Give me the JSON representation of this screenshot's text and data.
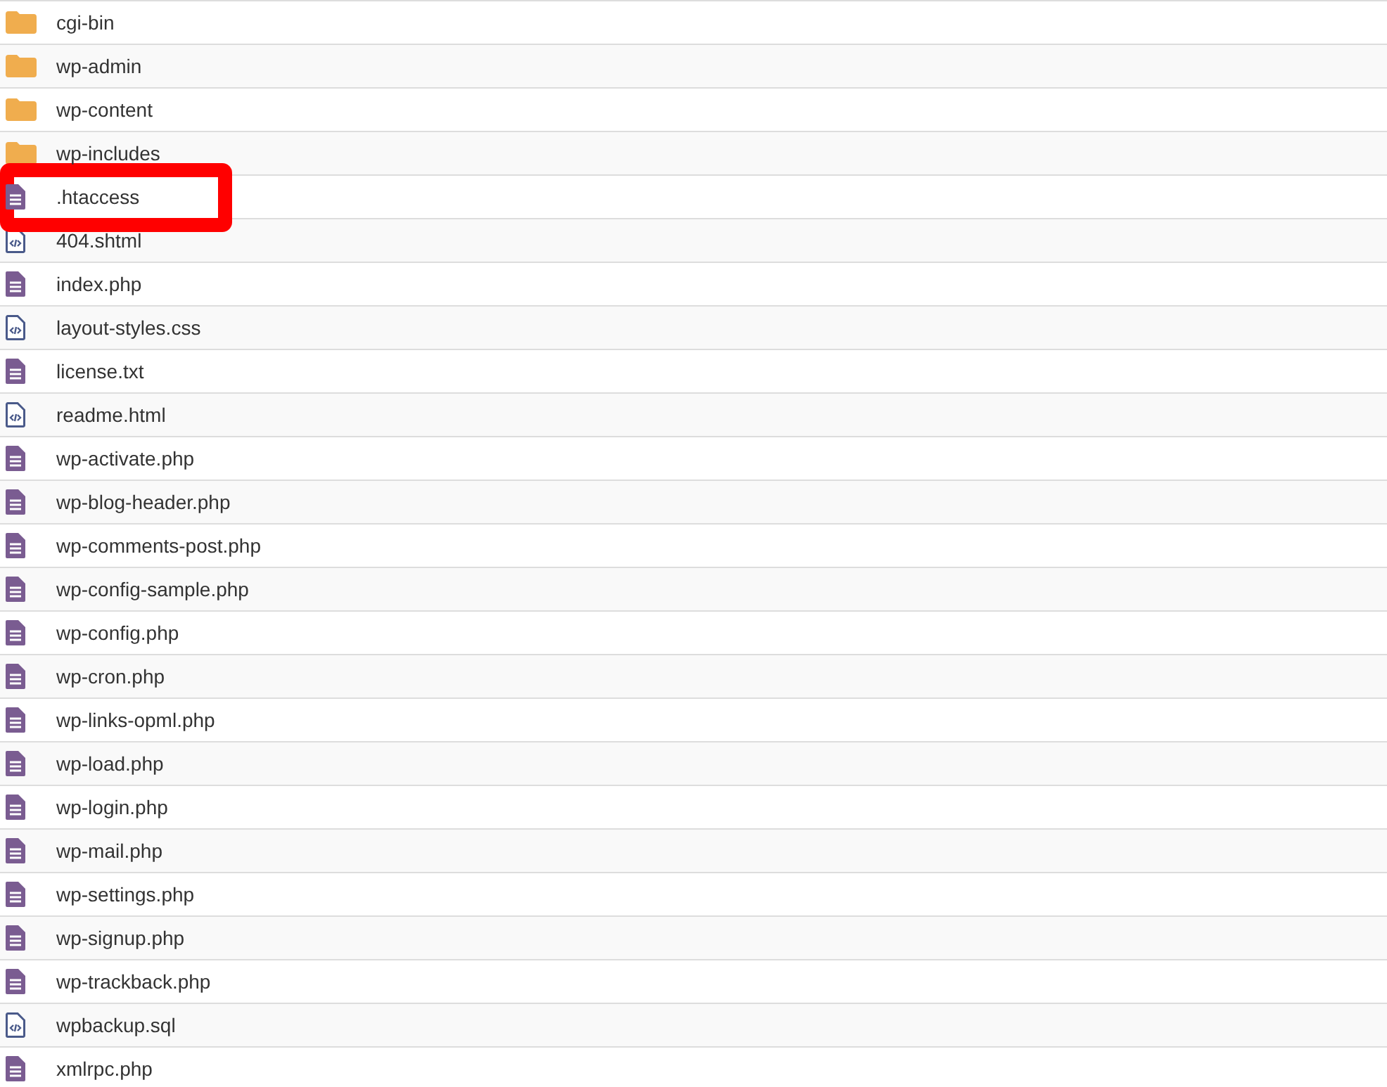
{
  "files": [
    {
      "name": "cgi-bin",
      "kind": "folder",
      "highlighted": false
    },
    {
      "name": "wp-admin",
      "kind": "folder",
      "highlighted": false
    },
    {
      "name": "wp-content",
      "kind": "folder",
      "highlighted": false
    },
    {
      "name": "wp-includes",
      "kind": "folder",
      "highlighted": false
    },
    {
      "name": ".htaccess",
      "kind": "text",
      "highlighted": true
    },
    {
      "name": "404.shtml",
      "kind": "code",
      "highlighted": false
    },
    {
      "name": "index.php",
      "kind": "text",
      "highlighted": false
    },
    {
      "name": "layout-styles.css",
      "kind": "code",
      "highlighted": false
    },
    {
      "name": "license.txt",
      "kind": "text",
      "highlighted": false
    },
    {
      "name": "readme.html",
      "kind": "code",
      "highlighted": false
    },
    {
      "name": "wp-activate.php",
      "kind": "text",
      "highlighted": false
    },
    {
      "name": "wp-blog-header.php",
      "kind": "text",
      "highlighted": false
    },
    {
      "name": "wp-comments-post.php",
      "kind": "text",
      "highlighted": false
    },
    {
      "name": "wp-config-sample.php",
      "kind": "text",
      "highlighted": false
    },
    {
      "name": "wp-config.php",
      "kind": "text",
      "highlighted": false
    },
    {
      "name": "wp-cron.php",
      "kind": "text",
      "highlighted": false
    },
    {
      "name": "wp-links-opml.php",
      "kind": "text",
      "highlighted": false
    },
    {
      "name": "wp-load.php",
      "kind": "text",
      "highlighted": false
    },
    {
      "name": "wp-login.php",
      "kind": "text",
      "highlighted": false
    },
    {
      "name": "wp-mail.php",
      "kind": "text",
      "highlighted": false
    },
    {
      "name": "wp-settings.php",
      "kind": "text",
      "highlighted": false
    },
    {
      "name": "wp-signup.php",
      "kind": "text",
      "highlighted": false
    },
    {
      "name": "wp-trackback.php",
      "kind": "text",
      "highlighted": false
    },
    {
      "name": "wpbackup.sql",
      "kind": "code",
      "highlighted": false
    },
    {
      "name": "xmlrpc.php",
      "kind": "text",
      "highlighted": false
    }
  ]
}
